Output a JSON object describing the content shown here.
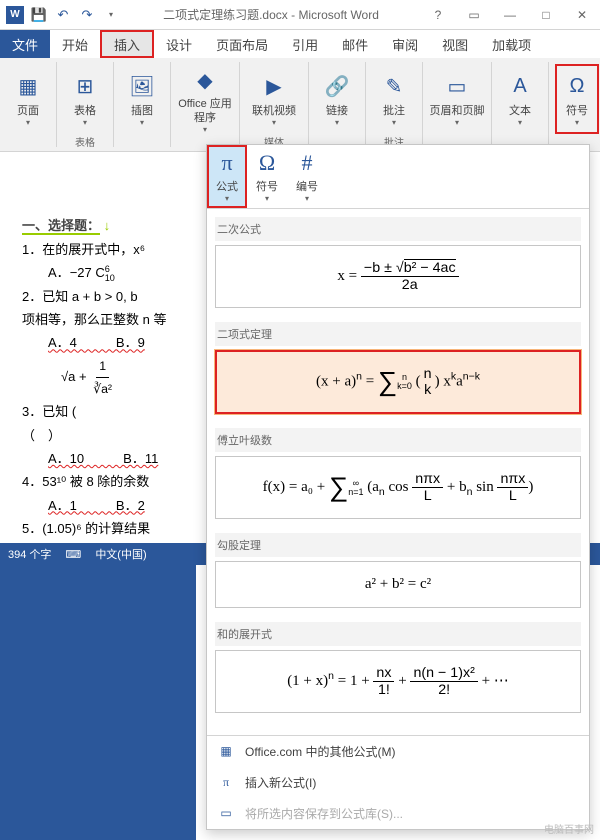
{
  "titlebar": {
    "doc_name": "二项式定理练习题.docx - Microsoft Word",
    "win": {
      "help": "?",
      "min": "—",
      "max": "□",
      "close": "✕"
    }
  },
  "tabs": {
    "file": "文件",
    "items": [
      "开始",
      "插入",
      "设计",
      "页面布局",
      "引用",
      "邮件",
      "审阅",
      "视图",
      "加载项"
    ],
    "active": "插入"
  },
  "ribbon": {
    "groups": [
      {
        "label": "",
        "items": [
          {
            "icon": "▦",
            "label": "页面"
          }
        ]
      },
      {
        "label": "表格",
        "items": [
          {
            "icon": "⊞",
            "label": "表格"
          }
        ]
      },
      {
        "label": "",
        "items": [
          {
            "icon": "🖼",
            "label": "插图"
          }
        ]
      },
      {
        "label": "",
        "items": [
          {
            "icon": "◆",
            "label": "Office\n应用程序"
          }
        ]
      },
      {
        "label": "媒体",
        "items": [
          {
            "icon": "▶",
            "label": "联机视频"
          }
        ]
      },
      {
        "label": "",
        "items": [
          {
            "icon": "🔗",
            "label": "链接"
          }
        ]
      },
      {
        "label": "批注",
        "items": [
          {
            "icon": "✎",
            "label": "批注"
          }
        ]
      },
      {
        "label": "",
        "items": [
          {
            "icon": "▭",
            "label": "页眉和页脚"
          }
        ]
      },
      {
        "label": "",
        "items": [
          {
            "icon": "A",
            "label": "文本"
          }
        ]
      },
      {
        "label": "",
        "items": [
          {
            "icon": "Ω",
            "label": "符号"
          }
        ]
      }
    ]
  },
  "document": {
    "title": "二项式定理练习题",
    "section": "一、选择题：",
    "lines": {
      "q1": "1．在的展开式中，x⁶",
      "qA": "A．",
      "aexpr_pre": "−27 C",
      "aexpr_sup": "6",
      "aexpr_sub": "10",
      "q2": "2．已知 a + b > 0, b",
      "q2b": "项相等，那么正整数 n 等",
      "q2opts": "A．4　　　B．9",
      "q3root": "√a + ",
      "q3_frac_num": "1",
      "q3_frac_den": "∛a²",
      "q3": "3．已知 (",
      "q3p": "（　）",
      "q3opts": "A．10　　　B．11",
      "q4": "4．53¹⁰ 被 8 除的余数",
      "q4opts": "A．1　　　B．2",
      "q5": "5．(1.05)⁶ 的计算结果"
    }
  },
  "equation_panel": {
    "toolbar": [
      {
        "icon": "π",
        "label": "公式",
        "hl": true
      },
      {
        "icon": "Ω",
        "label": "符号"
      },
      {
        "icon": "#",
        "label": "编号"
      }
    ],
    "groups": [
      {
        "label": "二次公式",
        "formula_html": "x = <span class='frac'><span class='num'>−b ± √<span style='border-top:1px solid #000'>b² − 4ac</span></span><span class='den'>2a</span></span>",
        "selected": false
      },
      {
        "label": "二项式定理",
        "formula_html": "(x + a)<sup>n</sup> = <span class='bigop'>∑</span><span class='supsub'><span>n</span><span>k=0</span></span> (<span class='frac'><span class='num' style='border:none'>n</span><span class='den'>k</span></span>) x<sup>k</sup>a<sup>n−k</sup>",
        "selected": true
      },
      {
        "label": "傅立叶级数",
        "formula_html": "f(x) = a₀ + <span class='bigop'>∑</span><span class='supsub'><span>∞</span><span>n=1</span></span> (a<sub>n</sub> cos <span class='frac'><span class='num'>nπx</span><span class='den'>L</span></span> + b<sub>n</sub> sin <span class='frac'><span class='num'>nπx</span><span class='den'>L</span></span>)",
        "selected": false
      },
      {
        "label": "勾股定理",
        "formula_html": "a² + b² = c²",
        "selected": false
      },
      {
        "label": "和的展开式",
        "formula_html": "(1 + x)<sup>n</sup> = 1 + <span class='frac'><span class='num'>nx</span><span class='den'>1!</span></span> + <span class='frac'><span class='num'>n(n − 1)x²</span><span class='den'>2!</span></span> + ⋯",
        "selected": false
      }
    ],
    "footer": {
      "more": "Office.com 中的其他公式(M)",
      "new": "插入新公式(I)",
      "save": "将所选内容保存到公式库(S)..."
    }
  },
  "statusbar": {
    "words": "394 个字",
    "lang_icon": "⌨",
    "lang": "中文(中国)"
  },
  "watermark": "电脑百事网"
}
